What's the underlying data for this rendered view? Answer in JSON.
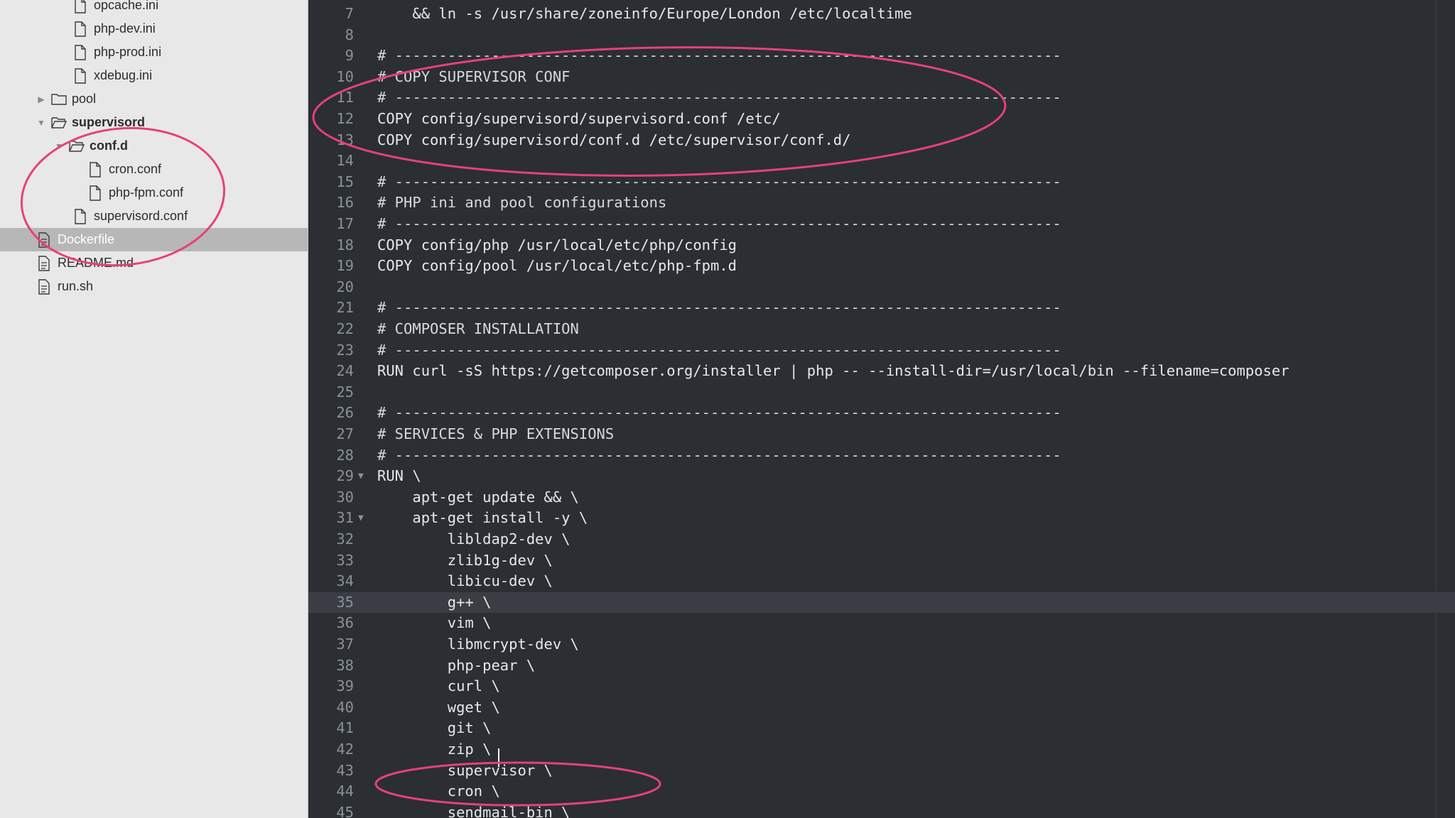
{
  "file_tree": [
    {
      "label": "opcache.ini",
      "kind": "file",
      "indent": 2
    },
    {
      "label": "php-dev.ini",
      "kind": "file",
      "indent": 2
    },
    {
      "label": "php-prod.ini",
      "kind": "file",
      "indent": 2
    },
    {
      "label": "xdebug.ini",
      "kind": "file",
      "indent": 2
    },
    {
      "label": "pool",
      "kind": "folder",
      "state": "collapsed",
      "indent": 1
    },
    {
      "label": "supervisord",
      "kind": "folder",
      "state": "expanded",
      "indent": 1
    },
    {
      "label": "conf.d",
      "kind": "folder",
      "state": "expanded",
      "indent": 2
    },
    {
      "label": "cron.conf",
      "kind": "file",
      "indent": 3
    },
    {
      "label": "php-fpm.conf",
      "kind": "file",
      "indent": 3
    },
    {
      "label": "supervisord.conf",
      "kind": "file",
      "indent": 2
    },
    {
      "label": "Dockerfile",
      "kind": "file",
      "indent": 0,
      "selected": true
    },
    {
      "label": "README.md",
      "kind": "file",
      "indent": 0
    },
    {
      "label": "run.sh",
      "kind": "file",
      "indent": 0
    }
  ],
  "editor": {
    "active_line": 35,
    "lines": [
      {
        "n": "7",
        "text": "    && ln -s /usr/share/zoneinfo/Europe/London /etc/localtime"
      },
      {
        "n": "8",
        "text": ""
      },
      {
        "n": "9",
        "text": "# ----------------------------------------------------------------------------"
      },
      {
        "n": "10",
        "text": "# COPY SUPERVISOR CONF"
      },
      {
        "n": "11",
        "text": "# ----------------------------------------------------------------------------"
      },
      {
        "n": "12",
        "text": "COPY config/supervisord/supervisord.conf /etc/"
      },
      {
        "n": "13",
        "text": "COPY config/supervisord/conf.d /etc/supervisor/conf.d/"
      },
      {
        "n": "14",
        "text": ""
      },
      {
        "n": "15",
        "text": "# ----------------------------------------------------------------------------"
      },
      {
        "n": "16",
        "text": "# PHP ini and pool configurations"
      },
      {
        "n": "17",
        "text": "# ----------------------------------------------------------------------------"
      },
      {
        "n": "18",
        "text": "COPY config/php /usr/local/etc/php/config"
      },
      {
        "n": "19",
        "text": "COPY config/pool /usr/local/etc/php-fpm.d"
      },
      {
        "n": "20",
        "text": ""
      },
      {
        "n": "21",
        "text": "# ----------------------------------------------------------------------------"
      },
      {
        "n": "22",
        "text": "# COMPOSER INSTALLATION"
      },
      {
        "n": "23",
        "text": "# ----------------------------------------------------------------------------"
      },
      {
        "n": "24",
        "text": "RUN curl -sS https://getcomposer.org/installer | php -- --install-dir=/usr/local/bin --filename=composer"
      },
      {
        "n": "25",
        "text": ""
      },
      {
        "n": "26",
        "text": "# ----------------------------------------------------------------------------"
      },
      {
        "n": "27",
        "text": "# SERVICES & PHP EXTENSIONS"
      },
      {
        "n": "28",
        "text": "# ----------------------------------------------------------------------------"
      },
      {
        "n": "29",
        "text": "RUN \\",
        "fold": true
      },
      {
        "n": "30",
        "text": "    apt-get update && \\"
      },
      {
        "n": "31",
        "text": "    apt-get install -y \\",
        "fold": true
      },
      {
        "n": "32",
        "text": "        libldap2-dev \\"
      },
      {
        "n": "33",
        "text": "        zlib1g-dev \\"
      },
      {
        "n": "34",
        "text": "        libicu-dev \\"
      },
      {
        "n": "35",
        "text": "        g++ \\"
      },
      {
        "n": "36",
        "text": "        vim \\"
      },
      {
        "n": "37",
        "text": "        libmcrypt-dev \\"
      },
      {
        "n": "38",
        "text": "        php-pear \\"
      },
      {
        "n": "39",
        "text": "        curl \\"
      },
      {
        "n": "40",
        "text": "        wget \\"
      },
      {
        "n": "41",
        "text": "        git \\"
      },
      {
        "n": "42",
        "text": "        zip \\"
      },
      {
        "n": "43",
        "text": "        supervisor \\"
      },
      {
        "n": "44",
        "text": "        cron \\"
      },
      {
        "n": "45",
        "text": "        sendmail-bin \\"
      }
    ]
  },
  "colors": {
    "editor_bg": "#2b2e33",
    "sidebar_bg": "#e8e8e8",
    "selected_row": "#b7b7b7",
    "annotation": "#e6407f",
    "code_text": "#e8e8e8",
    "line_number": "#8b9198"
  },
  "icons": {
    "file": "file-icon",
    "folder": "folder-icon",
    "script": "script-file-icon",
    "collapsed": "chevron-right-icon",
    "expanded": "chevron-down-icon",
    "fold": "fold-arrow-icon"
  }
}
